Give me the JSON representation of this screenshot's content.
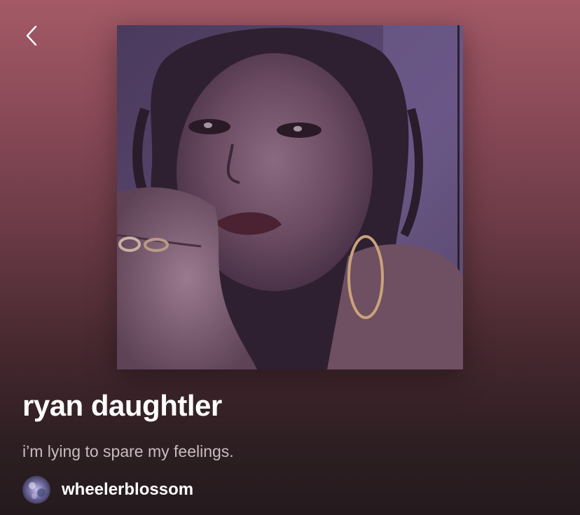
{
  "header": {
    "back_icon": "chevron-left-icon"
  },
  "playlist": {
    "title": "ryan daughtler",
    "description": "i’m lying to spare my feelings.",
    "owner": {
      "name": "wheelerblossom",
      "avatar_icon": "user-avatar"
    }
  },
  "colors": {
    "gradient_top": "#a35a66",
    "gradient_bottom": "#241a1d",
    "title": "#ffffff",
    "description": "#c9bcbf"
  }
}
